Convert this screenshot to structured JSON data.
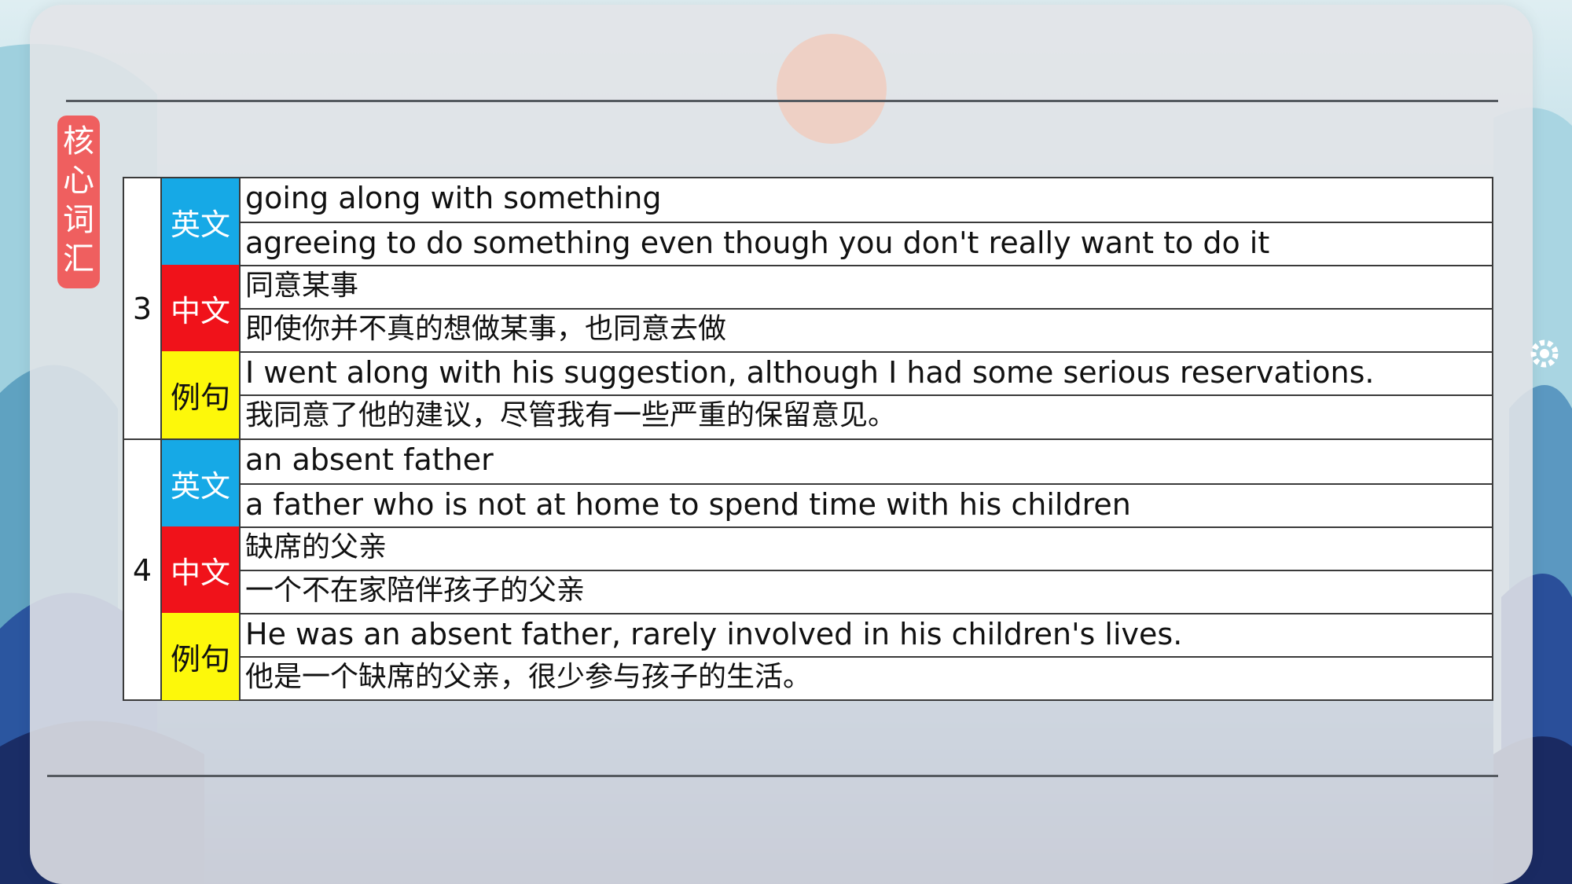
{
  "sidebar_tag": {
    "chars": [
      "核",
      "心",
      "词",
      "汇"
    ]
  },
  "colors": {
    "english_label": "#16a9e6",
    "chinese_label": "#f0121a",
    "example_label": "#fdf80a",
    "tag": "#ef5f5f"
  },
  "labels": {
    "english": "英文",
    "chinese": "中文",
    "example": "例句"
  },
  "entries": [
    {
      "number": "3",
      "english_term": "going along with something",
      "english_definition": "agreeing to do something even though you don't really want to do it",
      "chinese_term": "同意某事",
      "chinese_definition": "即使你并不真的想做某事，也同意去做",
      "example_en": "I went along with his suggestion, although I had some serious reservations.",
      "example_zh": "我同意了他的建议，尽管我有一些严重的保留意见。"
    },
    {
      "number": "4",
      "english_term": "an absent father",
      "english_definition": "a father who is not at home to spend time with his children",
      "chinese_term": "缺席的父亲",
      "chinese_definition": "一个不在家陪伴孩子的父亲",
      "example_en": "He was an absent father, rarely involved in his children's lives.",
      "example_zh": "他是一个缺席的父亲，很少参与孩子的生活。"
    }
  ]
}
